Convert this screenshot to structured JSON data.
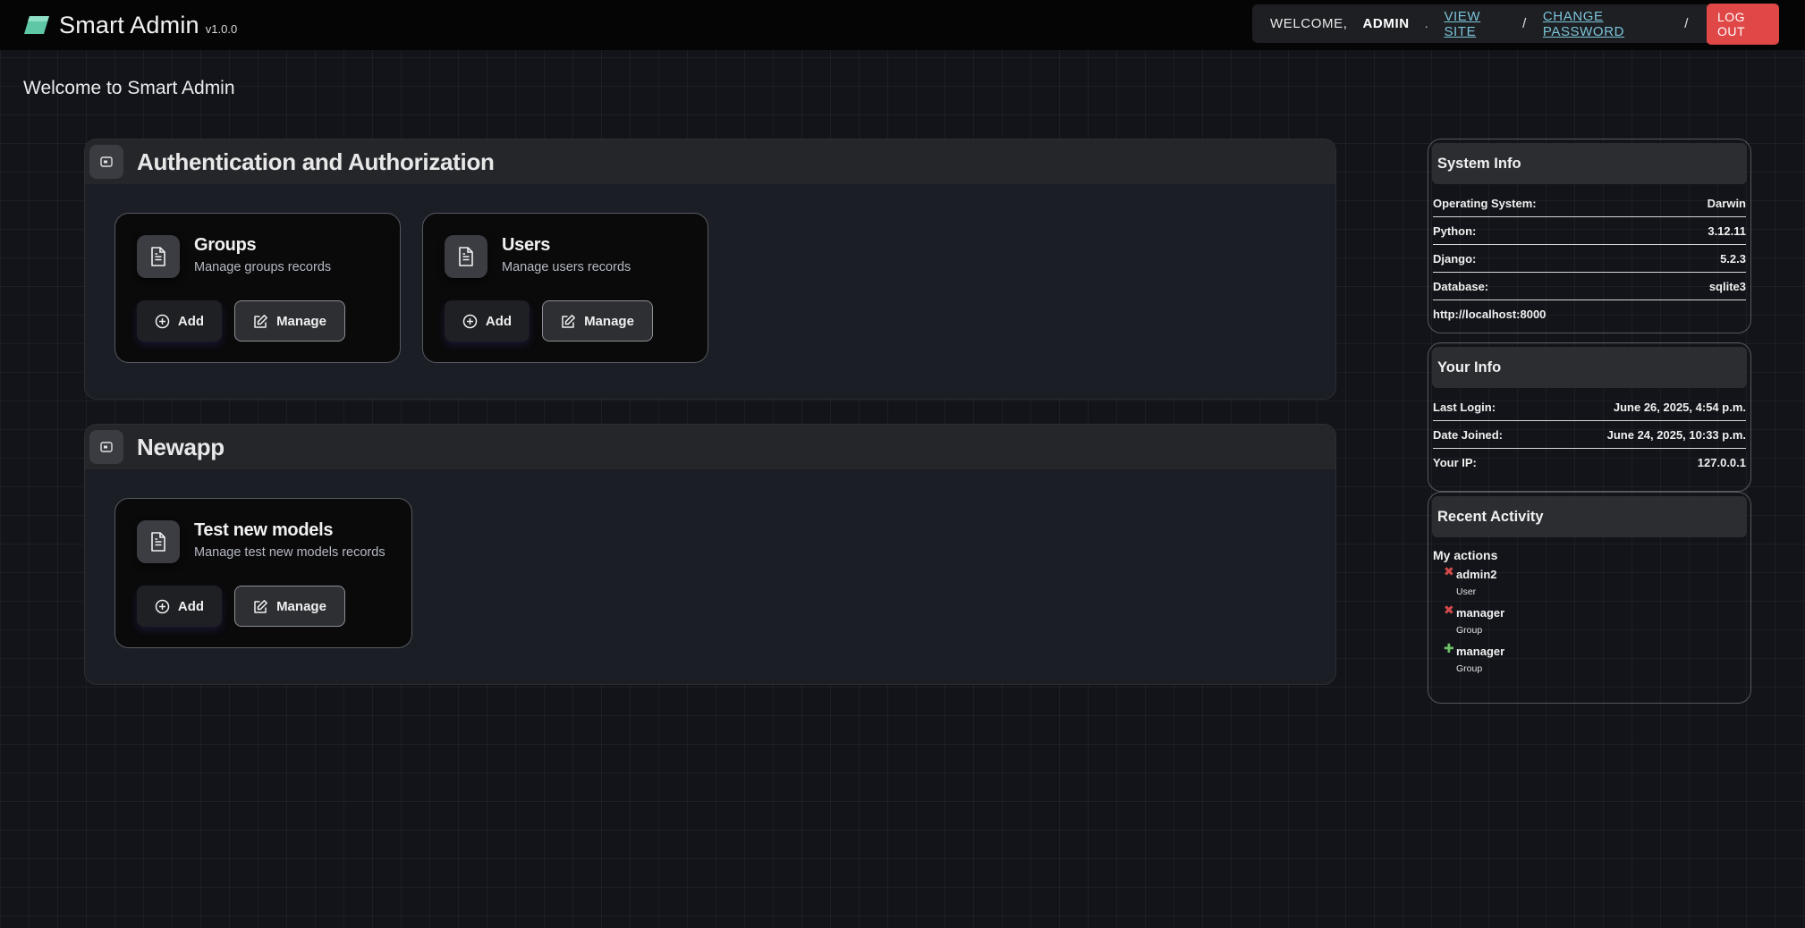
{
  "header": {
    "brand_name": "Smart Admin",
    "version": "v1.0.0",
    "welcome_label": "WELCOME,",
    "username": "ADMIN",
    "dot": ".",
    "view_site_label": "VIEW SITE",
    "separator": "/",
    "change_password_label": "CHANGE PASSWORD",
    "logout_label": "LOG OUT",
    "logo_color": "#5ec7a6"
  },
  "page": {
    "title": "Welcome to Smart Admin"
  },
  "apps": [
    {
      "title": "Authentication and Authorization",
      "models": [
        {
          "title": "Groups",
          "description": "Manage groups records",
          "add_label": "Add",
          "manage_label": "Manage"
        },
        {
          "title": "Users",
          "description": "Manage users records",
          "add_label": "Add",
          "manage_label": "Manage"
        }
      ]
    },
    {
      "title": "Newapp",
      "models": [
        {
          "title": "Test new models",
          "description": "Manage test new models records",
          "add_label": "Add",
          "manage_label": "Manage"
        }
      ]
    }
  ],
  "system_info": {
    "title": "System Info",
    "rows": [
      {
        "label": "Operating System:",
        "value": "Darwin"
      },
      {
        "label": "Python:",
        "value": "3.12.11"
      },
      {
        "label": "Django:",
        "value": "5.2.3"
      },
      {
        "label": "Database:",
        "value": "sqlite3"
      }
    ],
    "url": "http://localhost:8000"
  },
  "your_info": {
    "title": "Your Info",
    "rows": [
      {
        "label": "Last Login:",
        "value": "June 26, 2025, 4:54 p.m."
      },
      {
        "label": "Date Joined:",
        "value": "June 24, 2025, 10:33 p.m."
      },
      {
        "label": "Your IP:",
        "value": "127.0.0.1"
      }
    ]
  },
  "recent_activity": {
    "title": "Recent Activity",
    "subtitle": "My actions",
    "items": [
      {
        "action": "deletion",
        "mark": "✖",
        "name": "admin2",
        "type": "User"
      },
      {
        "action": "deletion",
        "mark": "✖",
        "name": "manager",
        "type": "Group"
      },
      {
        "action": "addition",
        "mark": "✚",
        "name": "manager",
        "type": "Group"
      }
    ]
  }
}
